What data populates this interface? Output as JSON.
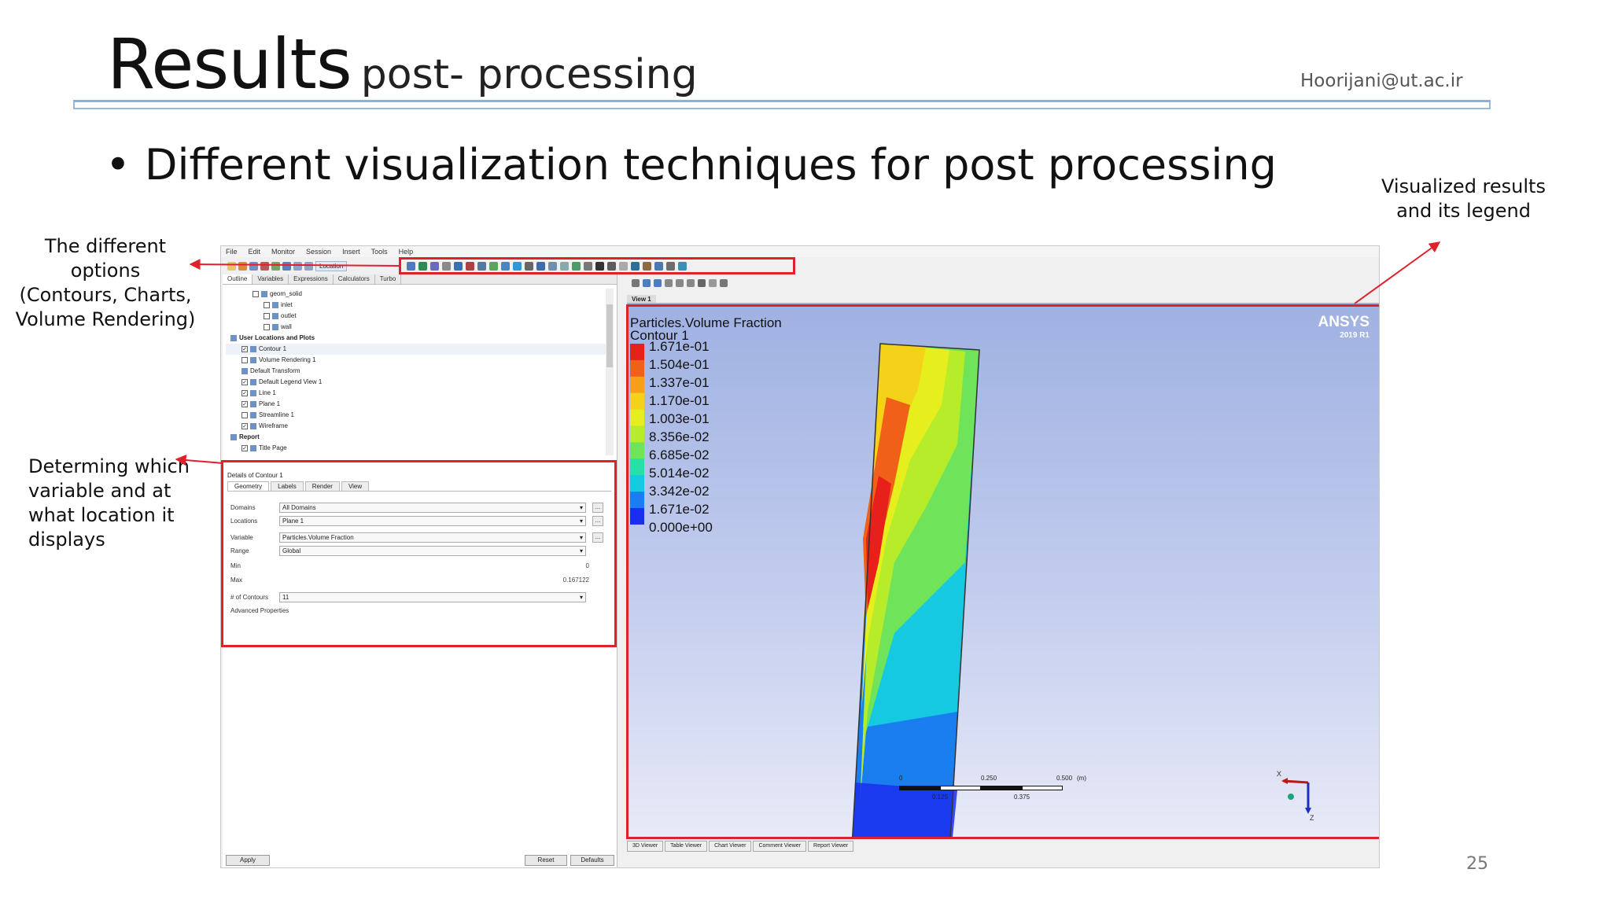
{
  "slide": {
    "title": "Results",
    "subtitle": "post- processing",
    "email": "Hoorijani@ut.ac.ir",
    "bullet": "Different visualization techniques for post processing",
    "page_number": "25"
  },
  "annotations": {
    "options": [
      "The different options",
      "(Contours,  Charts,",
      "Volume Rendering)"
    ],
    "variable": [
      "Determing which",
      "variable and at",
      "what location it",
      "displays"
    ],
    "results": [
      "Visualized results",
      "and its legend"
    ]
  },
  "app": {
    "menu": [
      "File",
      "Edit",
      "Monitor",
      "Session",
      "Insert",
      "Tools",
      "Help"
    ],
    "location_button": "Location",
    "tabs": [
      "Outline",
      "Variables",
      "Expressions",
      "Calculators",
      "Turbo"
    ],
    "tree": [
      {
        "label": "geom_solid",
        "indent": 2,
        "checked": false,
        "icon": true
      },
      {
        "label": "inlet",
        "indent": 3,
        "checked": false,
        "icon": true
      },
      {
        "label": "outlet",
        "indent": 3,
        "checked": false,
        "icon": true
      },
      {
        "label": "wall",
        "indent": 3,
        "checked": false,
        "icon": true
      },
      {
        "label": "User Locations and Plots",
        "indent": 0,
        "bold": true,
        "icon": true
      },
      {
        "label": "Contour 1",
        "indent": 1,
        "checked": true,
        "icon": true,
        "selected": true
      },
      {
        "label": "Volume Rendering 1",
        "indent": 1,
        "checked": false,
        "icon": true
      },
      {
        "label": "Default Transform",
        "indent": 1,
        "icon": true
      },
      {
        "label": "Default Legend View 1",
        "indent": 1,
        "checked": true,
        "icon": true
      },
      {
        "label": "Line 1",
        "indent": 1,
        "checked": true,
        "icon": true
      },
      {
        "label": "Plane 1",
        "indent": 1,
        "checked": true,
        "icon": true
      },
      {
        "label": "Streamline 1",
        "indent": 1,
        "checked": false,
        "icon": true
      },
      {
        "label": "Wireframe",
        "indent": 1,
        "checked": true,
        "icon": true
      },
      {
        "label": "Report",
        "indent": 0,
        "bold": true,
        "icon": true
      },
      {
        "label": "Title Page",
        "indent": 1,
        "checked": true,
        "icon": true
      }
    ],
    "details": {
      "title": "Details of Contour 1",
      "tabs": [
        "Geometry",
        "Labels",
        "Render",
        "View"
      ],
      "domains_label": "Domains",
      "domains_value": "All Domains",
      "locations_label": "Locations",
      "locations_value": "Plane 1",
      "variable_label": "Variable",
      "variable_value": "Particles.Volume Fraction",
      "range_label": "Range",
      "range_value": "Global",
      "min_label": "Min",
      "min_value": "0",
      "max_label": "Max",
      "max_value": "0.167122",
      "contours_label": "# of Contours",
      "contours_value": "11",
      "advanced_label": "Advanced Properties",
      "ellipsis": "...",
      "apply": "Apply",
      "reset": "Reset",
      "defaults": "Defaults"
    },
    "view_label": "View 1",
    "legend": {
      "title_line1": "Particles.Volume Fraction",
      "title_line2": "Contour 1",
      "values": [
        "1.671e-01",
        "1.504e-01",
        "1.337e-01",
        "1.170e-01",
        "1.003e-01",
        "8.356e-02",
        "6.685e-02",
        "5.014e-02",
        "3.342e-02",
        "1.671e-02",
        "0.000e+00"
      ],
      "colors": [
        "#e8201c",
        "#f06018",
        "#f5a017",
        "#f5d21a",
        "#e6ee1e",
        "#b7ec2b",
        "#6fe35a",
        "#27e0a8",
        "#14c9e0",
        "#1b7ef0",
        "#1a2ef0"
      ]
    },
    "brand": {
      "name": "ANSYS",
      "version": "2019 R1"
    },
    "scale_labels": [
      "0",
      "0.250",
      "0.500",
      "(m)",
      "0.125",
      "0.375"
    ],
    "axes": {
      "x": "X",
      "z": "Z"
    },
    "bottom_tabs": [
      "3D Viewer",
      "Table Viewer",
      "Chart Viewer",
      "Comment Viewer",
      "Report Viewer"
    ]
  }
}
